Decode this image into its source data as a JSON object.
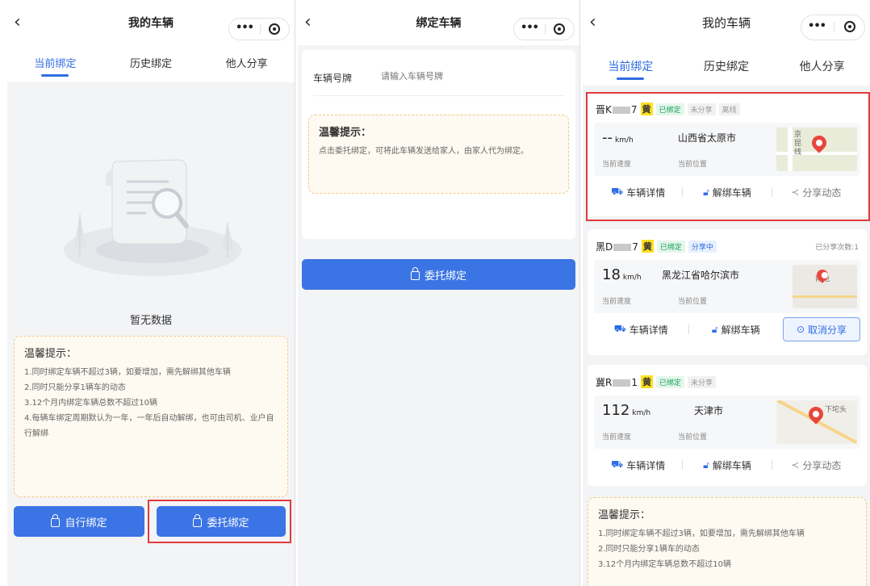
{
  "panel1": {
    "title": "我的车辆",
    "tabs": [
      "当前绑定",
      "历史绑定",
      "他人分享"
    ],
    "empty_text": "暂无数据",
    "tips_title": "温馨提示：",
    "tips": [
      "1.同时绑定车辆不超过3辆，如要增加，需先解绑其他车辆",
      "2.同时只能分享1辆车的动态",
      "3.12个月内绑定车辆总数不超过10辆",
      "4.每辆车绑定周期默认为一年，一年后自动解绑，也可由司机、业户自行解绑"
    ],
    "btn_self": "自行绑定",
    "btn_entrust": "委托绑定"
  },
  "panel2": {
    "title": "绑定车辆",
    "plate_label": "车辆号牌",
    "plate_placeholder": "请输入车辆号牌",
    "tips_title": "温馨提示：",
    "tips_text": "点击委托绑定，可将此车辆发送给家人，由家人代为绑定。",
    "btn_entrust": "委托绑定"
  },
  "panel3": {
    "title": "我的车辆",
    "tabs": [
      "当前绑定",
      "历史绑定",
      "他人分享"
    ],
    "speed_label": "当前速度",
    "location_label": "当前位置",
    "unit": "km/h",
    "detail": "车辆详情",
    "unbind": "解绑车辆",
    "share": "分享动态",
    "cancel_share": "取消分享",
    "vehicles": [
      {
        "prefix": "晋K",
        "suffix": "7",
        "color_tag": "黄",
        "tags": [
          "已绑定",
          "未分享",
          "离线"
        ],
        "speed": "--",
        "location": "山西省太原市",
        "map_text": "京昆线"
      },
      {
        "prefix": "黑D",
        "suffix": "7",
        "color_tag": "黄",
        "tags": [
          "已绑定",
          "分享中"
        ],
        "share_count": "已分享次数:1",
        "speed": "18",
        "location": "黑龙江省哈尔滨市",
        "map_text": "南屯"
      },
      {
        "prefix": "冀R",
        "suffix": "1",
        "color_tag": "黄",
        "tags": [
          "已绑定",
          "未分享"
        ],
        "speed": "112",
        "location": "天津市",
        "map_text": "下坨头"
      }
    ],
    "tips_title": "温馨提示：",
    "tips": [
      "1.同时绑定车辆不超过3辆，如要增加，需先解绑其他车辆",
      "2.同时只能分享1辆车的动态",
      "3.12个月内绑定车辆总数不超过10辆"
    ]
  },
  "colors": {
    "accent": "#2f6de1",
    "button": "#3b74e4",
    "highlight": "#e23a3a",
    "plate_yellow": "#ffdf20"
  }
}
